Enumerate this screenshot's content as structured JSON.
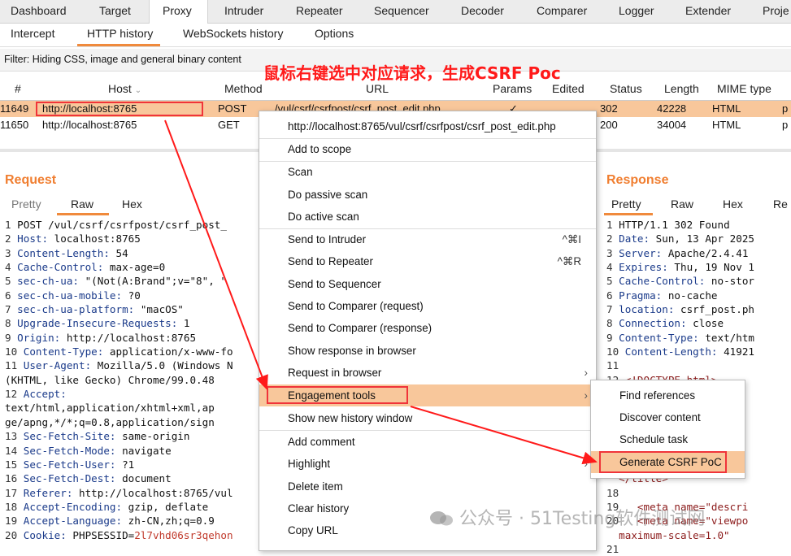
{
  "top_tabs": [
    "Dashboard",
    "Target",
    "Proxy",
    "Intruder",
    "Repeater",
    "Sequencer",
    "Decoder",
    "Comparer",
    "Logger",
    "Extender",
    "Proje"
  ],
  "sub_tabs": [
    "Intercept",
    "HTTP history",
    "WebSockets history",
    "Options"
  ],
  "filter_text": "Filter: Hiding CSS, image and general binary content",
  "annotation": "鼠标右键选中对应请求，生成CSRF Poc",
  "table": {
    "headers": [
      "#",
      "Host",
      "Method",
      "URL",
      "Params",
      "Edited",
      "Status",
      "Length",
      "MIME type"
    ],
    "rows": [
      {
        "num": "11649",
        "host": "http://localhost:8765",
        "method": "POST",
        "url": "/vul/csrf/csrfpost/csrf_post_edit.php",
        "params": "✓",
        "edited": "",
        "status": "302",
        "length": "42228",
        "mime": "HTML",
        "extra": "p"
      },
      {
        "num": "11650",
        "host": "http://localhost:8765",
        "method": "GET",
        "url": "",
        "params": "",
        "edited": "",
        "status": "200",
        "length": "34004",
        "mime": "HTML",
        "extra": "p"
      }
    ]
  },
  "request": {
    "title": "Request",
    "tabs": [
      "Pretty",
      "Raw",
      "Hex"
    ],
    "lines": [
      {
        "n": "1",
        "k": "",
        "v": "POST /vul/csrf/csrfpost/csrf_post_"
      },
      {
        "n": "2",
        "k": "Host",
        "v": " localhost:8765"
      },
      {
        "n": "3",
        "k": "Content-Length",
        "v": " 54"
      },
      {
        "n": "4",
        "k": "Cache-Control",
        "v": " max-age=0"
      },
      {
        "n": "5",
        "k": "sec-ch-ua",
        "v": " \"(Not(A:Brand\";v=\"8\", \""
      },
      {
        "n": "6",
        "k": "sec-ch-ua-mobile",
        "v": " ?0"
      },
      {
        "n": "7",
        "k": "sec-ch-ua-platform",
        "v": " \"macOS\""
      },
      {
        "n": "8",
        "k": "Upgrade-Insecure-Requests",
        "v": " 1"
      },
      {
        "n": "9",
        "k": "Origin",
        "v": " http://localhost:8765"
      },
      {
        "n": "10",
        "k": "Content-Type",
        "v": " application/x-www-fo"
      },
      {
        "n": "11",
        "k": "User-Agent",
        "v": " Mozilla/5.0 (Windows N"
      },
      {
        "n": "",
        "k": "",
        "v": "(KHTML, like Gecko) Chrome/99.0.48"
      },
      {
        "n": "12",
        "k": "Accept",
        "v": ""
      },
      {
        "n": "",
        "k": "",
        "v": "text/html,application/xhtml+xml,ap"
      },
      {
        "n": "",
        "k": "",
        "v": "ge/apng,*/*;q=0.8,application/sign"
      },
      {
        "n": "13",
        "k": "Sec-Fetch-Site",
        "v": " same-origin"
      },
      {
        "n": "14",
        "k": "Sec-Fetch-Mode",
        "v": " navigate"
      },
      {
        "n": "15",
        "k": "Sec-Fetch-User",
        "v": " ?1"
      },
      {
        "n": "16",
        "k": "Sec-Fetch-Dest",
        "v": " document"
      },
      {
        "n": "17",
        "k": "Referer",
        "v": " http://localhost:8765/vul"
      },
      {
        "n": "18",
        "k": "Accept-Encoding",
        "v": " gzip, deflate"
      },
      {
        "n": "19",
        "k": "Accept-Language",
        "v": " zh-CN,zh;q=0.9"
      },
      {
        "n": "20",
        "k": "Cookie",
        "v": " PHPSESSID=2l7vhd06sr3qehon"
      }
    ]
  },
  "response": {
    "title": "Response",
    "tabs": [
      "Pretty",
      "Raw",
      "Hex",
      "Re"
    ],
    "lines": [
      {
        "n": "1",
        "t": "HTTP/1.1 302 Found",
        "c": "plain"
      },
      {
        "n": "2",
        "t": "Date: Sun, 13 Apr 2025",
        "c": "kv"
      },
      {
        "n": "3",
        "t": "Server: Apache/2.4.41",
        "c": "kv"
      },
      {
        "n": "4",
        "t": "Expires: Thu, 19 Nov 1",
        "c": "kv"
      },
      {
        "n": "5",
        "t": "Cache-Control: no-stor",
        "c": "kv"
      },
      {
        "n": "6",
        "t": "Pragma: no-cache",
        "c": "kv"
      },
      {
        "n": "7",
        "t": "location: csrf_post.ph",
        "c": "kv"
      },
      {
        "n": "8",
        "t": "Connection: close",
        "c": "kv"
      },
      {
        "n": "9",
        "t": "Content-Type: text/htm",
        "c": "kv"
      },
      {
        "n": "10",
        "t": "Content-Length: 41921",
        "c": "kv"
      },
      {
        "n": "11",
        "t": "",
        "c": "plain"
      },
      {
        "n": "12",
        "t": "<!DOCTYPE html>",
        "c": "tag"
      },
      {
        "n": "",
        "t": "        >",
        "c": "tag"
      },
      {
        "n": "",
        "t": "",
        "c": "plain"
      },
      {
        "n": "",
        "t": "     equiv=\"",
        "c": "tag"
      },
      {
        "n": "",
        "t": "     et=\"utf",
        "c": "tag"
      },
      {
        "n": "",
        "t": "",
        "c": "plain"
      },
      {
        "n": "",
        "t": "     ikachu",
        "c": "plain"
      },
      {
        "n": "",
        "t": "  </title>",
        "c": "tag"
      },
      {
        "n": "18",
        "t": "",
        "c": "plain"
      },
      {
        "n": "19",
        "t": "  <meta name=\"descri",
        "c": "tag"
      },
      {
        "n": "20",
        "t": "  <meta name=\"viewpo",
        "c": "tag"
      },
      {
        "n": "",
        "t": "  maximum-scale=1.0\"",
        "c": "tag"
      },
      {
        "n": "21",
        "t": "",
        "c": "plain"
      }
    ]
  },
  "context_menu": {
    "items": [
      {
        "label": "http://localhost:8765/vul/csrf/csrfpost/csrf_post_edit.php",
        "shortcut": "",
        "submenu": false
      },
      {
        "label": "Add to scope",
        "shortcut": "",
        "submenu": false
      },
      {
        "label": "Scan",
        "shortcut": "",
        "submenu": false
      },
      {
        "label": "Do passive scan",
        "shortcut": "",
        "submenu": false
      },
      {
        "label": "Do active scan",
        "shortcut": "",
        "submenu": false
      },
      {
        "label": "Send to Intruder",
        "shortcut": "^⌘I",
        "submenu": false
      },
      {
        "label": "Send to Repeater",
        "shortcut": "^⌘R",
        "submenu": false
      },
      {
        "label": "Send to Sequencer",
        "shortcut": "",
        "submenu": false
      },
      {
        "label": "Send to Comparer (request)",
        "shortcut": "",
        "submenu": false
      },
      {
        "label": "Send to Comparer (response)",
        "shortcut": "",
        "submenu": false
      },
      {
        "label": "Show response in browser",
        "shortcut": "",
        "submenu": false
      },
      {
        "label": "Request in browser",
        "shortcut": "",
        "submenu": true
      },
      {
        "label": "Engagement tools",
        "shortcut": "",
        "submenu": true
      },
      {
        "label": "Show new history window",
        "shortcut": "",
        "submenu": false
      },
      {
        "label": "Add comment",
        "shortcut": "",
        "submenu": false
      },
      {
        "label": "Highlight",
        "shortcut": "",
        "submenu": true
      },
      {
        "label": "Delete item",
        "shortcut": "",
        "submenu": false
      },
      {
        "label": "Clear history",
        "shortcut": "",
        "submenu": false
      },
      {
        "label": "Copy URL",
        "shortcut": "",
        "submenu": false
      }
    ]
  },
  "engagement_submenu": [
    "Find references",
    "Discover content",
    "Schedule task",
    "Generate CSRF PoC"
  ],
  "watermark": "公众号 · 51Testing软件测试网",
  "colors": {
    "accent": "#f08a3c",
    "highlight": "#f8c79b",
    "annotation": "#ff1a1a"
  }
}
